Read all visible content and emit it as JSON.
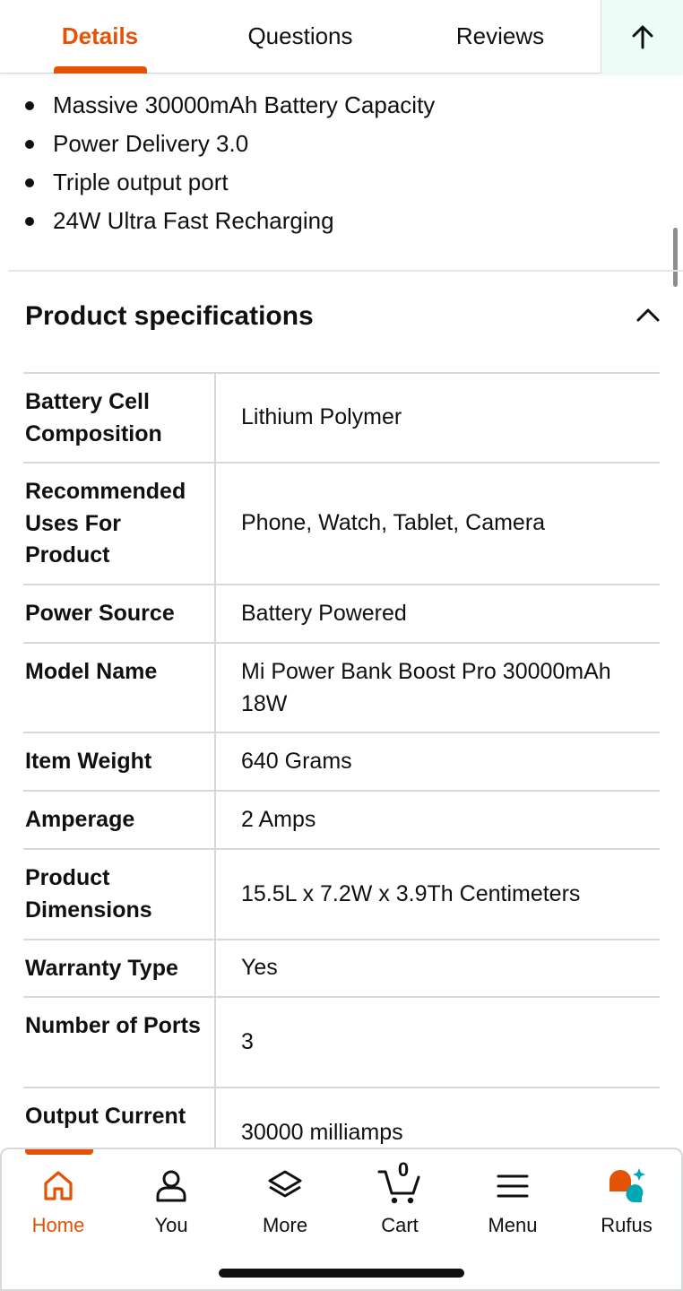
{
  "tabs": {
    "items": [
      "Details",
      "Questions",
      "Reviews"
    ],
    "active": "Details",
    "back_to_top_icon": "arrow-up-icon"
  },
  "highlights": [
    "Massive 30000mAh Battery Capacity",
    "Power Delivery 3.0",
    "Triple output port",
    "24W Ultra Fast Recharging"
  ],
  "specs": {
    "heading": "Product specifications",
    "toggle_icon": "chevron-up-icon",
    "rows": [
      {
        "key": "Battery Cell Composition",
        "value": "Lithium Polymer"
      },
      {
        "key": "Recommended Uses For Product",
        "value": "Phone, Watch, Tablet, Camera"
      },
      {
        "key": "Power Source",
        "value": "Battery Powered"
      },
      {
        "key": "Model Name",
        "value": "Mi Power Bank Boost Pro 30000mAh 18W"
      },
      {
        "key": "Item Weight",
        "value": "640 Grams"
      },
      {
        "key": "Amperage",
        "value": "2 Amps"
      },
      {
        "key": "Product Dimensions",
        "value": "15.5L x 7.2W x 3.9Th Centimeters"
      },
      {
        "key": "Warranty Type",
        "value": "Yes"
      },
      {
        "key": "Number of Ports",
        "value": "3"
      },
      {
        "key": "Output Current",
        "value": "30000 milliamps"
      }
    ]
  },
  "bottom_nav": {
    "items": [
      {
        "label": "Home",
        "icon": "home-icon"
      },
      {
        "label": "You",
        "icon": "user-icon"
      },
      {
        "label": "More",
        "icon": "layers-icon"
      },
      {
        "label": "Cart",
        "icon": "cart-icon"
      },
      {
        "label": "Menu",
        "icon": "menu-icon"
      },
      {
        "label": "Rufus",
        "icon": "rufus-icon"
      }
    ],
    "active": "Home",
    "cart_count": "0"
  },
  "colors": {
    "accent": "#e35205",
    "text": "#0f1111",
    "divider": "#d5d9d9",
    "rufus_teal": "#00a8b5"
  }
}
